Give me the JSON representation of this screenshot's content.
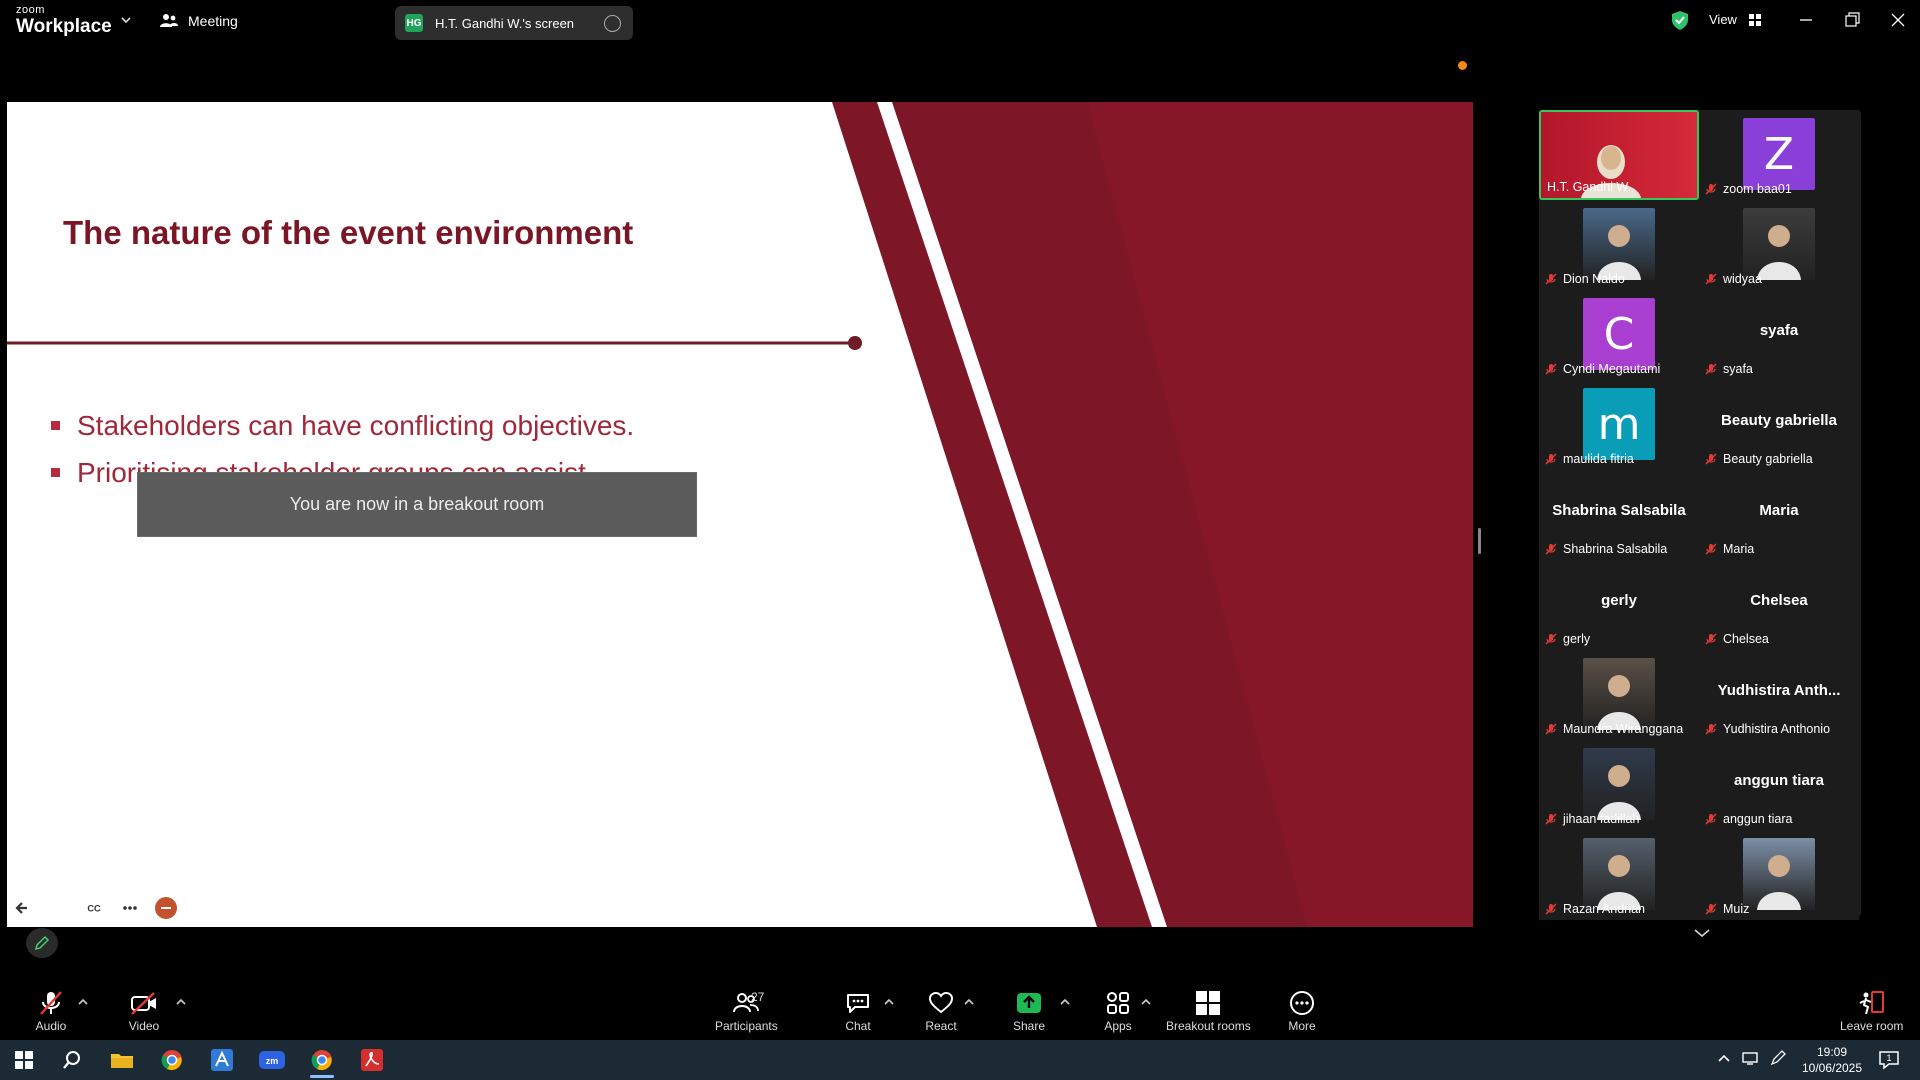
{
  "titlebar": {
    "brand_small": "zoom",
    "brand_big": "Workplace",
    "meeting_label": "Meeting",
    "screen_tab": {
      "initials": "HG",
      "label": "H.T. Gandhi W.'s screen"
    },
    "view_label": "View"
  },
  "slide": {
    "title": "The nature of the event environment",
    "bullets": [
      "Stakeholders can have conflicting objectives.",
      "Prioritising stakeholder groups can assist."
    ],
    "toast": "You are now in a breakout room"
  },
  "gallery": [
    {
      "name": "H.T. Gandhi W.",
      "kind": "video",
      "active": true
    },
    {
      "name": "zoom baa01",
      "kind": "letter",
      "letter": "Z",
      "color": "#8b3fd9"
    },
    {
      "name": "Dion Naldo",
      "kind": "photo"
    },
    {
      "name": "widyaa",
      "kind": "photo"
    },
    {
      "name": "Cyndi Megautami",
      "kind": "letter",
      "letter": "C",
      "color": "#a83fd0"
    },
    {
      "name": "syafa",
      "kind": "text",
      "big": "syafa"
    },
    {
      "name": "maulida fitria",
      "kind": "letter",
      "letter": "m",
      "color": "#0a9db8"
    },
    {
      "name": "Beauty gabriella",
      "kind": "text",
      "big": "Beauty gabriella"
    },
    {
      "name": "Shabrina Salsabila",
      "kind": "text",
      "big": "Shabrina Salsabila"
    },
    {
      "name": "Maria",
      "kind": "text",
      "big": "Maria"
    },
    {
      "name": "gerly",
      "kind": "text",
      "big": "gerly"
    },
    {
      "name": "Chelsea",
      "kind": "text",
      "big": "Chelsea"
    },
    {
      "name": "Maundra Wiranggana",
      "kind": "photo"
    },
    {
      "name": "Yudhistira Anthonio",
      "kind": "text",
      "big": "Yudhistira  Anth..."
    },
    {
      "name": "jihaan fadillah",
      "kind": "photo"
    },
    {
      "name": "anggun tiara",
      "kind": "text",
      "big": "anggun tiara"
    },
    {
      "name": "Razan Andrian",
      "kind": "photo"
    },
    {
      "name": "Muiz",
      "kind": "photo"
    }
  ],
  "toolbar": {
    "audio": "Audio",
    "video": "Video",
    "participants": "Participants",
    "participants_count": "27",
    "chat": "Chat",
    "react": "React",
    "share": "Share",
    "apps": "Apps",
    "breakout": "Breakout rooms",
    "more": "More",
    "leave": "Leave room"
  },
  "taskbar": {
    "time": "19:09",
    "date": "10/06/2025",
    "notifications": "1"
  },
  "colors": {
    "slide_maroon": "#7d1626",
    "toast_bg": "#5b5b5b",
    "active_border": "#34c85a",
    "share_green": "#1fb954",
    "recording": "#f38a1a"
  }
}
